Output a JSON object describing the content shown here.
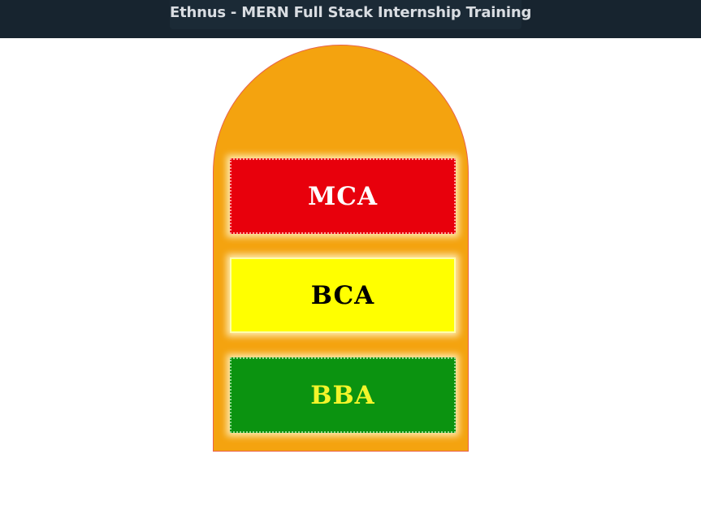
{
  "header": {
    "title": "Ethnus - MERN Full Stack Internship Training",
    "background_color": "#17242f"
  },
  "arch": {
    "fill_color": "#f4a30f",
    "border_color": "#e8624a"
  },
  "boxes": [
    {
      "label": "MCA",
      "background_color": "#e8000c",
      "text_color": "#ffffff"
    },
    {
      "label": "BCA",
      "background_color": "#ffff00",
      "text_color": "#000000"
    },
    {
      "label": "BBA",
      "background_color": "#0b9310",
      "text_color": "#f3f52a"
    }
  ]
}
